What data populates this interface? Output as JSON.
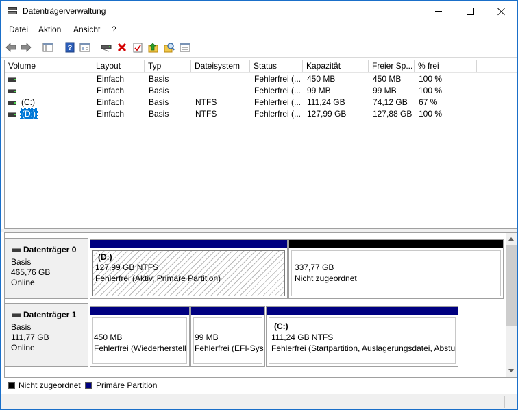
{
  "window": {
    "title": "Datenträgerverwaltung"
  },
  "menu": [
    "Datei",
    "Aktion",
    "Ansicht",
    "?"
  ],
  "toolbar": {
    "icons": [
      "back-icon",
      "forward-icon",
      "show-hide-console-tree-icon",
      "help-icon",
      "properties-icon",
      "connect-drive-icon",
      "delete-icon",
      "checkmark-icon",
      "folder-up-icon",
      "search-icon",
      "wizard-icon"
    ]
  },
  "volume_list": {
    "columns": [
      "Volume",
      "Layout",
      "Typ",
      "Dateisystem",
      "Status",
      "Kapazität",
      "Freier Sp...",
      "% frei"
    ],
    "rows": [
      {
        "volume": "",
        "layout": "Einfach",
        "typ": "Basis",
        "fs": "",
        "status": "Fehlerfrei (...",
        "capacity": "450 MB",
        "free": "450 MB",
        "pct": "100 %"
      },
      {
        "volume": "",
        "layout": "Einfach",
        "typ": "Basis",
        "fs": "",
        "status": "Fehlerfrei (...",
        "capacity": "99 MB",
        "free": "99 MB",
        "pct": "100 %"
      },
      {
        "volume": "(C:)",
        "layout": "Einfach",
        "typ": "Basis",
        "fs": "NTFS",
        "status": "Fehlerfrei (...",
        "capacity": "111,24 GB",
        "free": "74,12 GB",
        "pct": "67 %"
      },
      {
        "volume": "(D:)",
        "layout": "Einfach",
        "typ": "Basis",
        "fs": "NTFS",
        "status": "Fehlerfrei (...",
        "capacity": "127,99 GB",
        "free": "127,88 GB",
        "pct": "100 %"
      }
    ]
  },
  "disks": [
    {
      "name": "Datenträger 0",
      "type": "Basis",
      "size": "465,76 GB",
      "state": "Online",
      "partitions": [
        {
          "title": "(D:)",
          "size": "127,99 GB NTFS",
          "status": "Fehlerfrei (Aktiv, Primäre Partition)"
        },
        {
          "title": "",
          "size": "337,77 GB",
          "status": "Nicht zugeordnet"
        }
      ]
    },
    {
      "name": "Datenträger 1",
      "type": "Basis",
      "size": "111,77 GB",
      "state": "Online",
      "partitions": [
        {
          "title": "",
          "size": "450 MB",
          "status": "Fehlerfrei (Wiederherstell"
        },
        {
          "title": "",
          "size": "99 MB",
          "status": "Fehlerfrei (EFI-Sys"
        },
        {
          "title": "(C:)",
          "size": "111,24 GB NTFS",
          "status": "Fehlerfrei (Startpartition, Auslagerungsdatei, Abstu"
        }
      ]
    }
  ],
  "legend": [
    {
      "label": "Nicht zugeordnet",
      "color": "#000000"
    },
    {
      "label": "Primäre Partition",
      "color": "#000080"
    }
  ]
}
